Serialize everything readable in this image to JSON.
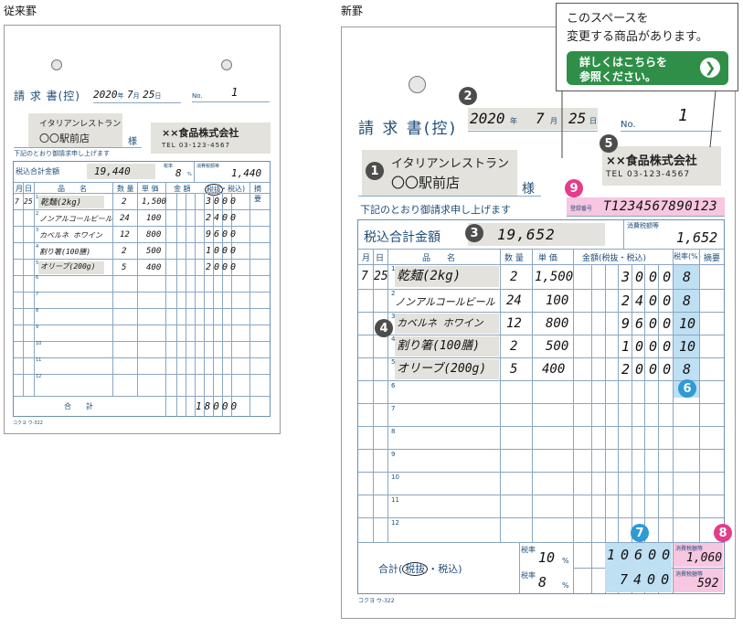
{
  "titles": {
    "old": "従来罫",
    "new": "新罫"
  },
  "old": {
    "title": "請 求 書(控)",
    "date": {
      "year": "2020",
      "year_unit": "年",
      "month": "7",
      "month_unit": "月",
      "day": "25",
      "day_unit": "日"
    },
    "no_label": "No.",
    "no_value": "1",
    "customer": [
      "イタリアンレストラン",
      "〇〇駅前店"
    ],
    "sama": "様",
    "company": "××食品株式会社",
    "tel": "TEL 03-123-4567",
    "note": "下記のとおり御請求申し上げます",
    "total_label": "税込合計金額",
    "total_value": "19,440",
    "tax_rate_label": "税率",
    "tax_rate_value": "8",
    "tax_rate_unit": "%",
    "tax_amount_label": "消費税額等",
    "tax_amount_value": "1,440",
    "headers": [
      "月",
      "日",
      "品　　名",
      "数 量",
      "単 価",
      "金 額",
      "税抜",
      "・税込)",
      "摘 要"
    ],
    "rows": [
      {
        "m": "7",
        "d": "25",
        "n": "1",
        "item": "乾麺(2kg)",
        "qty": "2",
        "price": "1,500",
        "amount": "3000"
      },
      {
        "m": "",
        "d": "",
        "n": "2",
        "item": "ノンアルコールビール",
        "qty": "24",
        "price": "100",
        "amount": "2400"
      },
      {
        "m": "",
        "d": "",
        "n": "3",
        "item": "カベルネ ホワイン",
        "qty": "12",
        "price": "800",
        "amount": "9600"
      },
      {
        "m": "",
        "d": "",
        "n": "4",
        "item": "割り箸(100膳)",
        "qty": "2",
        "price": "500",
        "amount": "1000"
      },
      {
        "m": "",
        "d": "",
        "n": "5",
        "item": "オリーブ(200g)",
        "qty": "5",
        "price": "400",
        "amount": "2000"
      }
    ],
    "empty_rows": [
      "6",
      "7",
      "8",
      "9",
      "10",
      "11",
      "12"
    ],
    "sum_label": "合　　計",
    "sum_value": "18000",
    "footer": "コクヨ ウ-322"
  },
  "new": {
    "title": "請 求 書(控)",
    "date": {
      "year": "2020",
      "year_unit": "年",
      "month": "7",
      "month_unit": "月",
      "day": "25",
      "day_unit": "日"
    },
    "no_label": "No.",
    "no_value": "1",
    "customer": [
      "イタリアンレストラン",
      "〇〇駅前店"
    ],
    "sama": "様",
    "company": "××食品株式会社",
    "tel": "TEL 03-123-4567",
    "note": "下記のとおり御請求申し上げます",
    "reg_label": "登録番号",
    "reg_value": "T1234567890123",
    "total_label": "税込合計金額",
    "total_value": "19,652",
    "tax_amount_label": "消費税額等",
    "tax_amount_value": "1,652",
    "headers": [
      "月",
      "日",
      "品　　名",
      "数 量",
      "単 価",
      "金額(税抜・税込)",
      "税率(%)",
      "摘要"
    ],
    "rows": [
      {
        "m": "7",
        "d": "25",
        "n": "1",
        "item": "乾麺(2kg)",
        "qty": "2",
        "price": "1,500",
        "amount": "3000",
        "rate": "8"
      },
      {
        "m": "",
        "d": "",
        "n": "2",
        "item": "ノンアルコールビール",
        "qty": "24",
        "price": "100",
        "amount": "2400",
        "rate": "8"
      },
      {
        "m": "",
        "d": "",
        "n": "3",
        "item": "カベルネ ホワイン",
        "qty": "12",
        "price": "800",
        "amount": "9600",
        "rate": "10"
      },
      {
        "m": "",
        "d": "",
        "n": "4",
        "item": "割り箸(100膳)",
        "qty": "2",
        "price": "500",
        "amount": "1000",
        "rate": "10"
      },
      {
        "m": "",
        "d": "",
        "n": "5",
        "item": "オリーブ(200g)",
        "qty": "5",
        "price": "400",
        "amount": "2000",
        "rate": "8"
      }
    ],
    "empty_rows": [
      "6",
      "7",
      "8",
      "9",
      "10",
      "11",
      "12"
    ],
    "sum_label": "合計",
    "sum_circled": "税抜",
    "sum_rest": "・税込)",
    "sum_open": "(",
    "rate_label": "税率",
    "rate1": "10",
    "rate2": "8",
    "rate_unit": "%",
    "sum1": "10600",
    "sum2": "7400",
    "tax1_label": "消費税額等",
    "tax1": "1,060",
    "tax2_label": "消費税額等",
    "tax2": "592",
    "footer": "コクヨ ウ-322"
  },
  "callout": {
    "line1": "このスペースを",
    "line2": "変更する商品があります。",
    "btn1": "詳しくはこちらを",
    "btn2": "参照ください。",
    "arrow": "❯"
  },
  "markers": [
    "2",
    "5",
    "9",
    "1",
    "3",
    "4",
    "6",
    "7",
    "8"
  ],
  "colors": {
    "navy": "#1f4e79",
    "gray": "#e3e2dc",
    "pink": "#f7c6e0",
    "blue": "#bfdff3",
    "green": "#2f8f48",
    "marker_blue": "#2e9bd6",
    "marker_pink": "#e43c8a",
    "marker_dark": "#4d4d4d"
  }
}
